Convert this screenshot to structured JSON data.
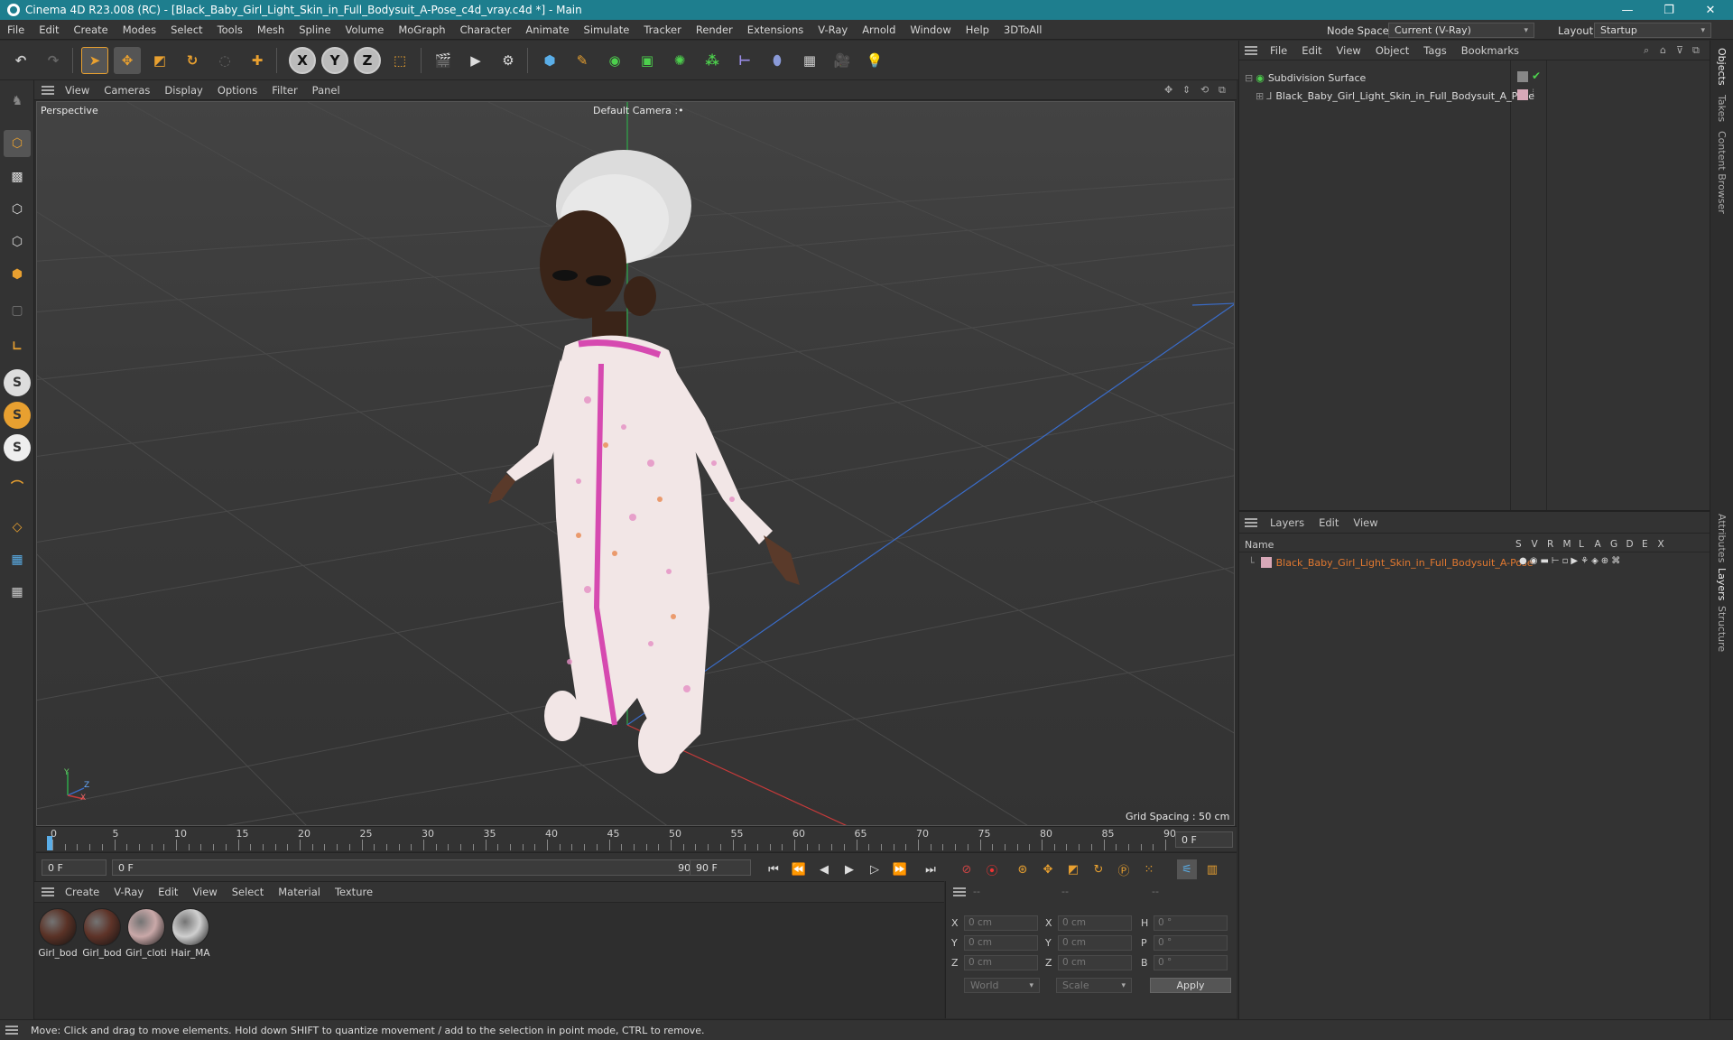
{
  "window": {
    "title": "Cinema 4D R23.008 (RC) - [Black_Baby_Girl_Light_Skin_in_Full_Bodysuit_A-Pose_c4d_vray.c4d *] - Main",
    "minimize": "—",
    "restore": "❐",
    "close": "✕"
  },
  "menubar": {
    "items": [
      "File",
      "Edit",
      "Create",
      "Modes",
      "Select",
      "Tools",
      "Mesh",
      "Spline",
      "Volume",
      "MoGraph",
      "Character",
      "Animate",
      "Simulate",
      "Tracker",
      "Render",
      "Extensions",
      "V-Ray",
      "Arnold",
      "Window",
      "Help",
      "3DToAll"
    ],
    "node_space_label": "Node Space:",
    "node_space_value": "Current (V-Ray)",
    "layout_label": "Layout:",
    "layout_value": "Startup"
  },
  "toolbar": {
    "axis_x": "X",
    "axis_y": "Y",
    "axis_z": "Z"
  },
  "left_toolbar": {
    "s1": "S",
    "s2": "S",
    "s3": "S"
  },
  "viewport": {
    "menu": [
      "View",
      "Cameras",
      "Display",
      "Options",
      "Filter",
      "Panel"
    ],
    "view_name": "Perspective",
    "camera": "Default Camera",
    "camera_suffix": ":•",
    "grid_spacing": "Grid Spacing : 50 cm",
    "axis_y": "Y",
    "axis_z": "Z",
    "axis_x": "X"
  },
  "timeline": {
    "ticks": [
      "0",
      "5",
      "10",
      "15",
      "20",
      "25",
      "30",
      "35",
      "40",
      "45",
      "50",
      "55",
      "60",
      "65",
      "70",
      "75",
      "80",
      "85",
      "90"
    ],
    "current_frame": "0 F",
    "start": "0 F",
    "range_start": "0 F",
    "range_end": "90 F",
    "end": "90 F"
  },
  "materials": {
    "menu": [
      "Create",
      "V-Ray",
      "Edit",
      "View",
      "Select",
      "Material",
      "Texture"
    ],
    "items": [
      {
        "label": "Girl_bod",
        "color": "#5a3226"
      },
      {
        "label": "Girl_bod",
        "color": "#5e3328"
      },
      {
        "label": "Girl_cloti",
        "color": "#c9a8a8"
      },
      {
        "label": "Hair_MA",
        "color": "#cfcfcf"
      }
    ]
  },
  "coordinates": {
    "header": [
      "--",
      "--",
      "--"
    ],
    "rows": [
      {
        "a": "X",
        "av": "0 cm",
        "b": "X",
        "bv": "0 cm",
        "c": "H",
        "cv": "0 °"
      },
      {
        "a": "Y",
        "av": "0 cm",
        "b": "Y",
        "bv": "0 cm",
        "c": "P",
        "cv": "0 °"
      },
      {
        "a": "Z",
        "av": "0 cm",
        "b": "Z",
        "bv": "0 cm",
        "c": "B",
        "cv": "0 °"
      }
    ],
    "mode": "World",
    "transform": "Scale",
    "apply": "Apply"
  },
  "objects": {
    "menu": [
      "File",
      "Edit",
      "View",
      "Object",
      "Tags",
      "Bookmarks"
    ],
    "items": [
      {
        "name": "Subdivision Surface"
      },
      {
        "name": "Black_Baby_Girl_Light_Skin_in_Full_Bodysuit_A_Pose"
      }
    ]
  },
  "layers": {
    "menu": [
      "Layers",
      "Edit",
      "View"
    ],
    "name_header": "Name",
    "flag_headers": [
      "S",
      "V",
      "R",
      "M",
      "L",
      "A",
      "G",
      "D",
      "E",
      "X"
    ],
    "items": [
      {
        "name": "Black_Baby_Girl_Light_Skin_in_Full_Bodysuit_A-Pose",
        "color": "#e07830"
      }
    ]
  },
  "right_tabs": [
    "Objects",
    "Takes",
    "Content Browser",
    "Attributes",
    "Layers",
    "Structure"
  ],
  "status": {
    "text": "Move: Click and drag to move elements. Hold down SHIFT to quantize movement / add to the selection in point mode, CTRL to remove."
  },
  "colors": {
    "titlebar": "#1e7e8e",
    "accent_orange": "#e8a030",
    "selected_layer": "#e07830"
  }
}
